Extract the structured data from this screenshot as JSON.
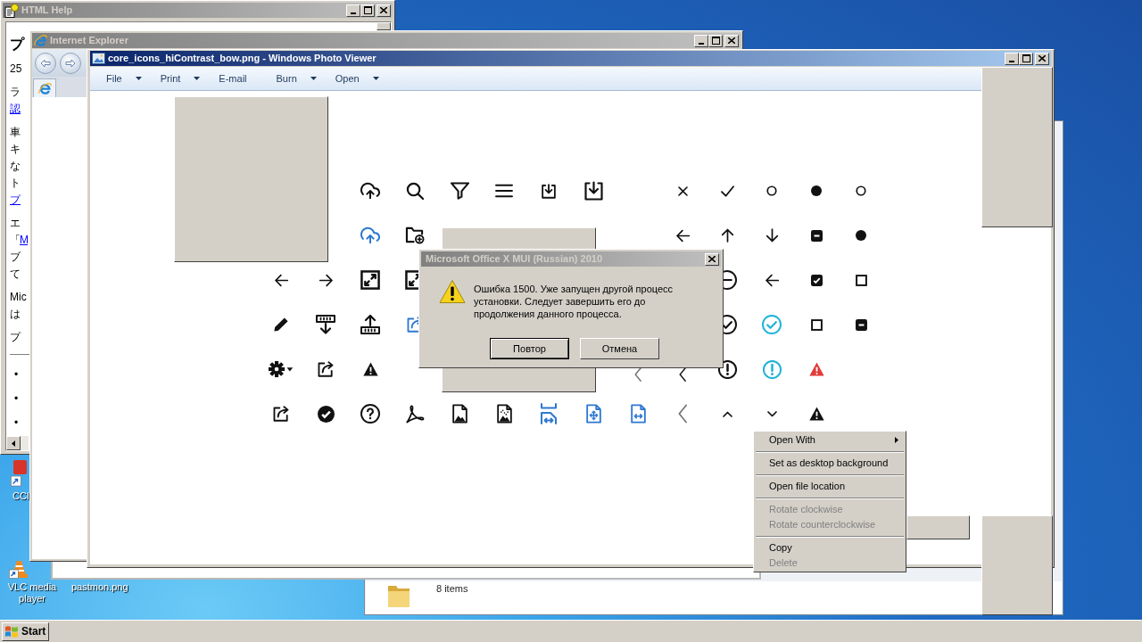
{
  "desktop_icons": [
    {
      "label": "CCl"
    },
    {
      "label": "VLC media player"
    },
    {
      "label": "pastmon.png"
    }
  ],
  "help_window": {
    "title": "HTML Help",
    "active": false,
    "content": [
      {
        "kind": "heading",
        "lines": [
          [
            {
              "text": "プ",
              "link": false
            }
          ]
        ]
      },
      {
        "kind": "paragraph",
        "lines": [
          [
            {
              "text": "25",
              "link": false
            }
          ]
        ]
      },
      {
        "kind": "paragraph",
        "lines": [
          [
            {
              "text": "ラ",
              "link": false
            }
          ],
          [
            {
              "text": "認",
              "link": true
            }
          ]
        ]
      },
      {
        "kind": "paragraph",
        "lines": [
          [
            {
              "text": "車",
              "link": false
            }
          ],
          [
            {
              "text": "キ",
              "link": false
            }
          ],
          [
            {
              "text": "な",
              "link": false
            }
          ],
          [
            {
              "text": "ト",
              "link": false
            }
          ],
          [
            {
              "text": "プ",
              "link": true
            }
          ]
        ]
      },
      {
        "kind": "paragraph",
        "lines": [
          [
            {
              "text": "エ",
              "link": false
            }
          ],
          [
            {
              "text": "「",
              "link": false
            },
            {
              "text": "M",
              "link": true
            }
          ],
          [
            {
              "text": "ブ",
              "link": false
            }
          ],
          [
            {
              "text": "て",
              "link": false
            }
          ]
        ]
      },
      {
        "kind": "paragraph",
        "lines": [
          [
            {
              "text": "Mic",
              "link": false
            }
          ],
          [
            {
              "text": "は",
              "link": false
            }
          ]
        ]
      },
      {
        "kind": "paragraph",
        "lines": [
          [
            {
              "text": "プ",
              "link": false
            }
          ]
        ]
      },
      {
        "kind": "rule"
      },
      {
        "kind": "bullets",
        "items": [
          {
            "marker": "•"
          },
          {
            "marker": "•"
          },
          {
            "marker": "•"
          }
        ]
      }
    ]
  },
  "ie_window": {
    "title": "Internet Explorer",
    "active": false
  },
  "photo_viewer": {
    "title": "core_icons_hiContrast_bow.png - Windows Photo Viewer",
    "active": true,
    "menu": [
      {
        "label": "File",
        "dropdown": true
      },
      {
        "label": "Print",
        "dropdown": true
      },
      {
        "label": "E-mail",
        "dropdown": false
      },
      {
        "label": "Burn",
        "dropdown": true
      },
      {
        "label": "Open",
        "dropdown": true
      }
    ]
  },
  "dialog": {
    "title": "Microsoft Office X MUI (Russian) 2010",
    "active": false,
    "message": "Ошибка 1500. Уже запущен другой процесс\nустановки. Следует завершить его до\nпродолжения данного процесса.",
    "buttons": [
      {
        "label": "Повтор",
        "default": true
      },
      {
        "label": "Отмена",
        "default": false
      }
    ]
  },
  "context_menu": {
    "items": [
      {
        "kind": "item",
        "label": "Open With",
        "submenu": true,
        "disabled": false
      },
      {
        "kind": "separator"
      },
      {
        "kind": "item",
        "label": "Set as desktop background",
        "submenu": false,
        "disabled": false
      },
      {
        "kind": "separator"
      },
      {
        "kind": "item",
        "label": "Open file location",
        "submenu": false,
        "disabled": false
      },
      {
        "kind": "separator"
      },
      {
        "kind": "item",
        "label": "Rotate clockwise",
        "submenu": false,
        "disabled": true
      },
      {
        "kind": "item",
        "label": "Rotate counterclockwise",
        "submenu": false,
        "disabled": true
      },
      {
        "kind": "separator"
      },
      {
        "kind": "item",
        "label": "Copy",
        "submenu": false,
        "disabled": false
      },
      {
        "kind": "item",
        "label": "Delete",
        "submenu": false,
        "disabled": true
      }
    ]
  },
  "explorer": {
    "status": "8 items"
  },
  "taskbar": {
    "start_label": "Start"
  }
}
